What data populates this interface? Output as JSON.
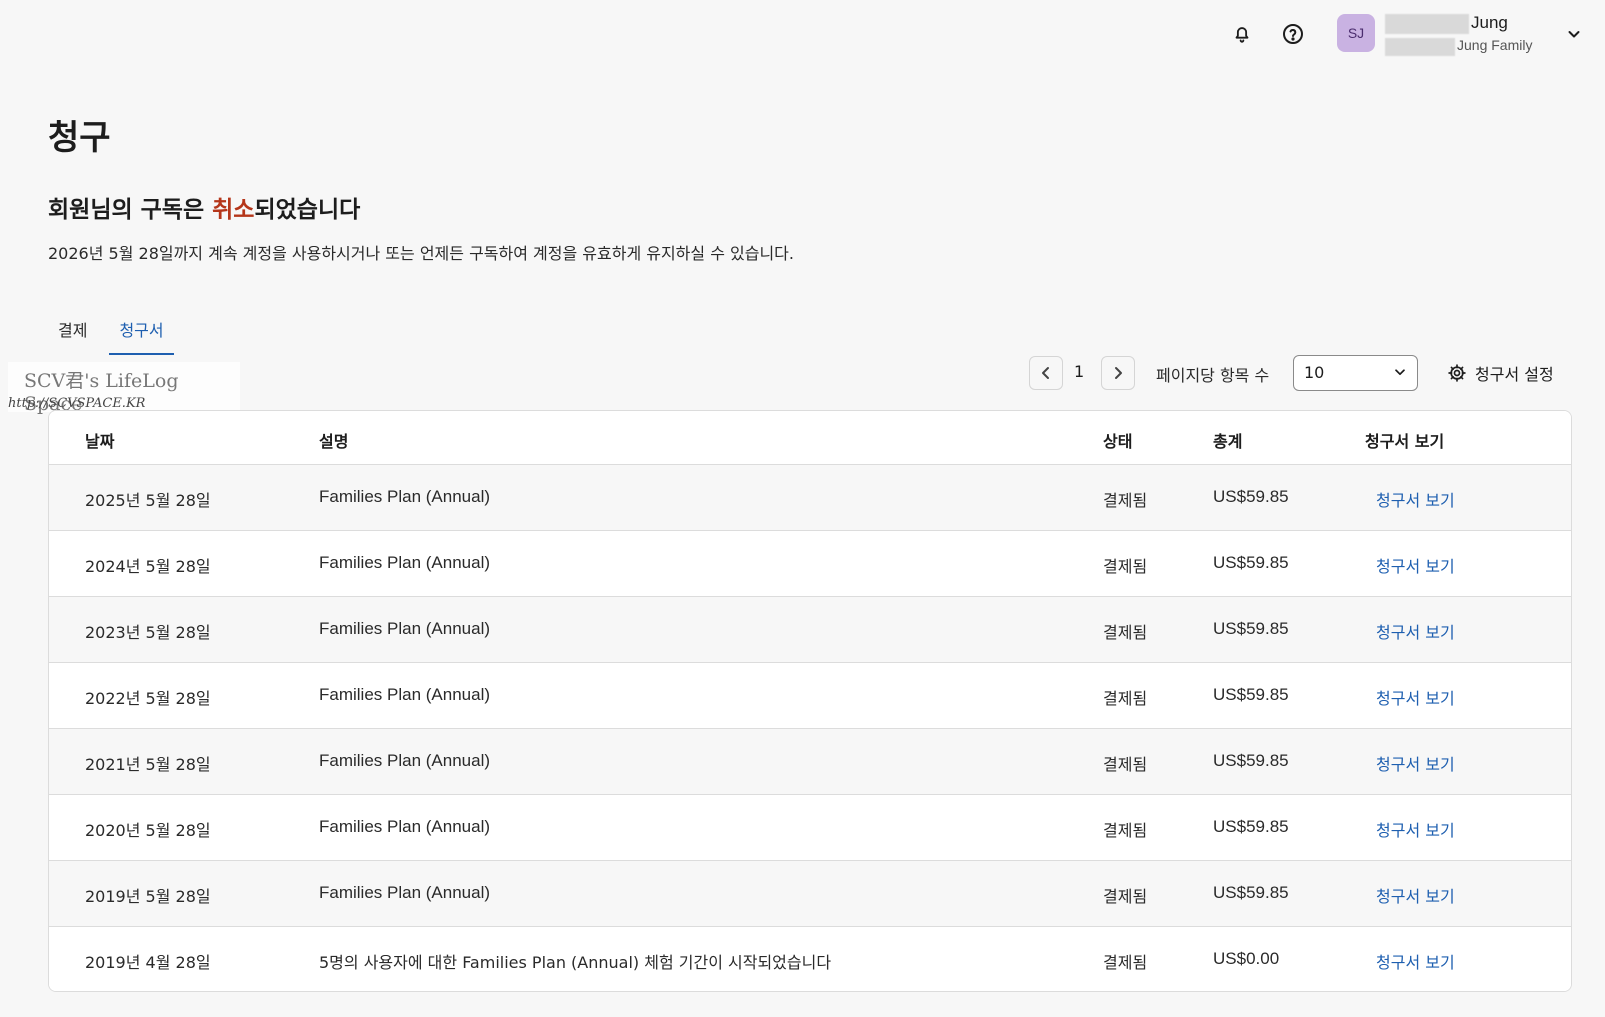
{
  "header": {
    "avatar_initials": "SJ",
    "user_name": "Jung",
    "user_family": "Jung Family",
    "icons": [
      "bell-icon",
      "help-circle-icon",
      "chevron-down-icon"
    ]
  },
  "page": {
    "title": "청구",
    "notice_prefix": "회원님의 구독은 ",
    "notice_accent": "취소",
    "notice_suffix": "되었습니다",
    "notice_body": "2026년 5월 28일까지 계속 계정을 사용하시거나 또는 언제든 구독하여 계정을 유효하게 유지하실 수 있습니다.",
    "accent_color": "#b5361a",
    "link_color": "#1e5fb0"
  },
  "tabs": [
    {
      "label": "결제",
      "active": false
    },
    {
      "label": "청구서",
      "active": true
    }
  ],
  "watermark": {
    "line1": "SCV君's LifeLog Space",
    "line2": "http://SCVSPACE.KR"
  },
  "toolbar": {
    "page_number": "1",
    "per_page_label": "페이지당 항목 수",
    "per_page_value": "10",
    "invoice_settings_label": "청구서 설정"
  },
  "table": {
    "columns": [
      "날짜",
      "설명",
      "상태",
      "총계",
      "청구서 보기"
    ],
    "rows": [
      {
        "date": "2025년 5월 28일",
        "desc": "Families Plan (Annual)",
        "status": "결제됨",
        "total": "US$59.85",
        "view": "청구서 보기"
      },
      {
        "date": "2024년 5월 28일",
        "desc": "Families Plan (Annual)",
        "status": "결제됨",
        "total": "US$59.85",
        "view": "청구서 보기"
      },
      {
        "date": "2023년 5월 28일",
        "desc": "Families Plan (Annual)",
        "status": "결제됨",
        "total": "US$59.85",
        "view": "청구서 보기"
      },
      {
        "date": "2022년 5월 28일",
        "desc": "Families Plan (Annual)",
        "status": "결제됨",
        "total": "US$59.85",
        "view": "청구서 보기"
      },
      {
        "date": "2021년 5월 28일",
        "desc": "Families Plan (Annual)",
        "status": "결제됨",
        "total": "US$59.85",
        "view": "청구서 보기"
      },
      {
        "date": "2020년 5월 28일",
        "desc": "Families Plan (Annual)",
        "status": "결제됨",
        "total": "US$59.85",
        "view": "청구서 보기"
      },
      {
        "date": "2019년 5월 28일",
        "desc": "Families Plan (Annual)",
        "status": "결제됨",
        "total": "US$59.85",
        "view": "청구서 보기"
      },
      {
        "date": "2019년 4월 28일",
        "desc": "5명의 사용자에 대한 Families Plan (Annual) 체험 기간이 시작되었습니다",
        "status": "결제됨",
        "total": "US$0.00",
        "view": "청구서 보기"
      }
    ]
  }
}
